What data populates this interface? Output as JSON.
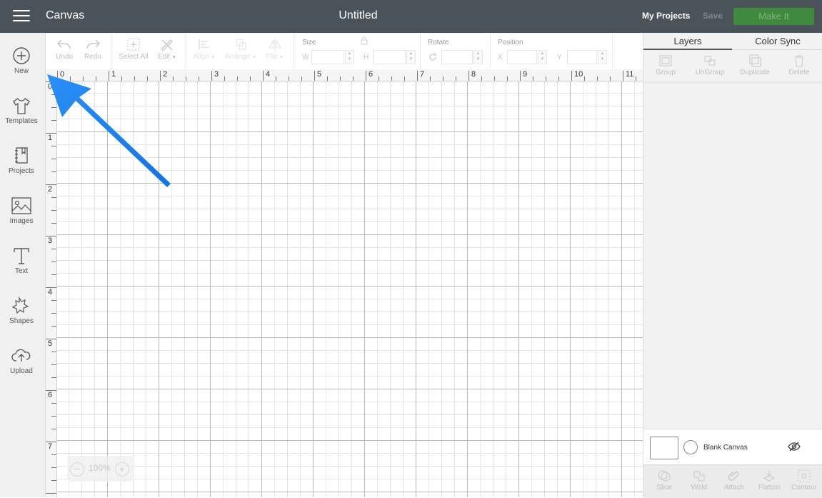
{
  "topbar": {
    "app_title": "Canvas",
    "doc_title": "Untitled",
    "my_projects": "My Projects",
    "save": "Save",
    "make_it": "Make It"
  },
  "sidebar": {
    "items": [
      {
        "label": "New",
        "icon": "plus-circle-icon"
      },
      {
        "label": "Templates",
        "icon": "tshirt-icon"
      },
      {
        "label": "Projects",
        "icon": "notebook-icon"
      },
      {
        "label": "Images",
        "icon": "image-icon"
      },
      {
        "label": "Text",
        "icon": "text-icon"
      },
      {
        "label": "Shapes",
        "icon": "shapes-icon"
      },
      {
        "label": "Upload",
        "icon": "cloud-upload-icon"
      }
    ]
  },
  "toolbar": {
    "undo": "Undo",
    "redo": "Redo",
    "select_all": "Select All",
    "edit": "Edit",
    "align": "Align",
    "arrange": "Arrange",
    "flip": "Flip",
    "size_label": "Size",
    "w_label": "W",
    "h_label": "H",
    "rotate_label": "Rotate",
    "position_label": "Position",
    "x_label": "X",
    "y_label": "Y"
  },
  "canvas": {
    "ruler_top": [
      "0",
      "1",
      "2",
      "3",
      "4",
      "5",
      "6",
      "7",
      "8",
      "9",
      "10",
      "11"
    ],
    "ruler_left": [
      "0",
      "1",
      "2",
      "3",
      "4",
      "5",
      "6",
      "7"
    ],
    "zoom": "100%"
  },
  "right_panel": {
    "tabs": [
      "Layers",
      "Color Sync"
    ],
    "layer_tools": [
      "Group",
      "UnGroup",
      "Duplicate",
      "Delete"
    ],
    "blank_canvas": "Blank Canvas",
    "bottom_tools": [
      "Slice",
      "Weld",
      "Attach",
      "Flatten",
      "Contour"
    ]
  },
  "colors": {
    "topbar": "#4a535a",
    "make_it": "#3f8a3f",
    "annotation_arrow": "#1e90ff"
  }
}
